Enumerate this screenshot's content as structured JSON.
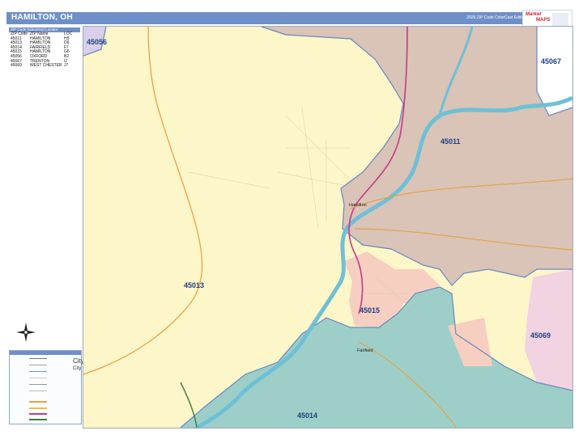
{
  "header": {
    "title": "HAMILTON, OH",
    "edition": "2026 ZIP Code ColorCast Edition"
  },
  "brand": {
    "line1": "Market",
    "line2": "MAPS"
  },
  "zip_index": {
    "heading": "ZIP Code Index/Grid Locator",
    "columns": [
      "ZIP Code",
      "ZIP Name",
      "LOC"
    ],
    "rows": [
      [
        "45011",
        "HAMILTON",
        "H5"
      ],
      [
        "45013",
        "HAMILTON",
        "D6"
      ],
      [
        "45014",
        "FAIRFIELD",
        "F7"
      ],
      [
        "45015",
        "HAMILTON",
        "G6"
      ],
      [
        "45056",
        "OXFORD",
        "B2"
      ],
      [
        "45067",
        "TRENTON",
        "I2"
      ],
      [
        "45069",
        "WEST CHESTER",
        "J7"
      ]
    ]
  },
  "legend": {
    "city_large": "City",
    "city_small": "City"
  },
  "map": {
    "zip_labels": {
      "z45056": "45056",
      "z45067": "45067",
      "z45011": "45011",
      "z45013": "45013",
      "z45015": "45015",
      "z45069": "45069",
      "z45014": "45014"
    },
    "places": {
      "hamilton": "Hamilton",
      "fairfield": "Fairfield"
    },
    "colors": {
      "z45013": "#fdf6c8",
      "z45011": "#d9c4b7",
      "z45014": "#9dcfc8",
      "z45015": "#f6cfc0",
      "z45069": "#f2d3e1",
      "z45056": "#d9cfe8",
      "z45067": "#ffffff",
      "river": "#6fc0d6",
      "highway": "#c53a8a",
      "road": "#e7a24a"
    }
  }
}
